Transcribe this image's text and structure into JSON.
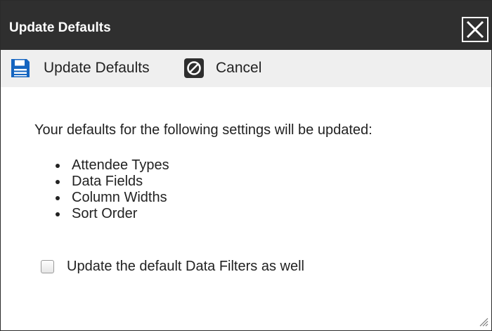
{
  "dialog": {
    "title": "Update Defaults",
    "close_icon": "close-icon"
  },
  "toolbar": {
    "update_label": "Update Defaults",
    "update_icon": "save-icon",
    "cancel_label": "Cancel",
    "cancel_icon": "cancel-icon"
  },
  "content": {
    "intro": "Your defaults for the following settings will be updated:",
    "settings": [
      "Attendee Types",
      "Data Fields",
      "Column Widths",
      "Sort Order"
    ],
    "checkbox": {
      "label": "Update the default Data Filters as well",
      "checked": false
    }
  },
  "colors": {
    "titlebar": "#2f2f2f",
    "toolbar": "#efefef",
    "save_icon": "#1565c0"
  }
}
